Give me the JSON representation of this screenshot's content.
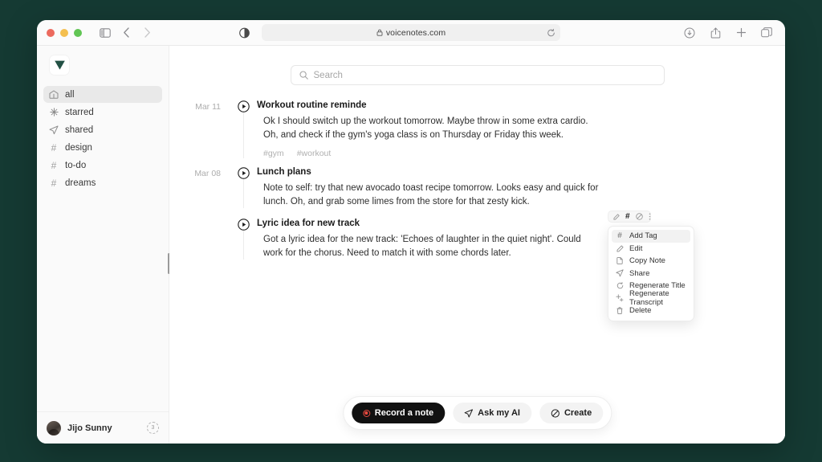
{
  "browser": {
    "url": "voicenotes.com",
    "icons": {
      "sidebar_toggle": "sidebar-toggle-icon",
      "back": "back-chevron-icon",
      "forward": "forward-chevron-icon",
      "shield": "shield-privacy-icon",
      "lock": "lock-icon",
      "reload": "reload-icon",
      "downloads": "download-icon",
      "share": "share-icon",
      "new_tab": "plus-icon",
      "tabs": "tabs-overview-icon"
    },
    "traffic_lights": [
      "close",
      "minimize",
      "zoom"
    ]
  },
  "sidebar": {
    "logo_name": "voicenotes-logo",
    "items": [
      {
        "label": "all",
        "icon": "archive-icon",
        "active": true
      },
      {
        "label": "starred",
        "icon": "sparkle-icon",
        "active": false
      },
      {
        "label": "shared",
        "icon": "paper-plane-icon",
        "active": false
      },
      {
        "label": "design",
        "icon": "hash-icon",
        "active": false
      },
      {
        "label": "to-do",
        "icon": "hash-icon",
        "active": false
      },
      {
        "label": "dreams",
        "icon": "hash-icon",
        "active": false
      }
    ],
    "user": {
      "name": "Jijo Sunny",
      "badge": "3"
    }
  },
  "search": {
    "placeholder": "Search",
    "value": "",
    "icon": "search-icon"
  },
  "notes": [
    {
      "date": "Mar 11",
      "title": "Workout routine reminde",
      "text": "Ok I should switch up the workout tomorrow. Maybe throw in some extra cardio. Oh, and check if the gym's yoga class is on Thursday or Friday this week.",
      "tags": [
        "#gym",
        "#workout"
      ]
    },
    {
      "date": "Mar 08",
      "title": "Lunch plans",
      "text": "Note to self: try that new avocado toast recipe tomorrow. Looks easy and quick for lunch. Oh, and grab some limes from the store for that zesty kick.",
      "tags": []
    },
    {
      "date": "",
      "title": "Lyric idea for new track",
      "text": "Got a lyric idea for the new track: 'Echoes of laughter in the quiet night'. Could work for the chorus. Need to match it with some chords later.",
      "tags": []
    }
  ],
  "context_menu": {
    "toolbar_icons": [
      "edit-pencil-icon",
      "hash-icon",
      "circle-slash-icon",
      "more-vertical-icon"
    ],
    "items": [
      {
        "label": "Add Tag",
        "icon": "hash-icon",
        "active": true
      },
      {
        "label": "Edit",
        "icon": "edit-pencil-icon",
        "active": false
      },
      {
        "label": "Copy Note",
        "icon": "copy-note-icon",
        "active": false
      },
      {
        "label": "Share",
        "icon": "paper-plane-icon",
        "active": false
      },
      {
        "label": "Regenerate Title",
        "icon": "refresh-icon",
        "active": false
      },
      {
        "label": "Regenerate Transcript",
        "icon": "sparkle-icon",
        "active": false
      },
      {
        "label": "Delete",
        "icon": "trash-icon",
        "active": false
      }
    ]
  },
  "bottom_bar": {
    "record_label": "Record a note",
    "ask_label": "Ask my AI",
    "create_label": "Create",
    "record_icon": "record-circle-icon",
    "ask_icon": "paper-plane-icon",
    "create_icon": "circle-slash-icon",
    "record_accent": "#e8493f"
  },
  "colors": {
    "desktop_background": "#153a33",
    "sidebar_background": "#fafafa",
    "record_button": "#111111"
  }
}
